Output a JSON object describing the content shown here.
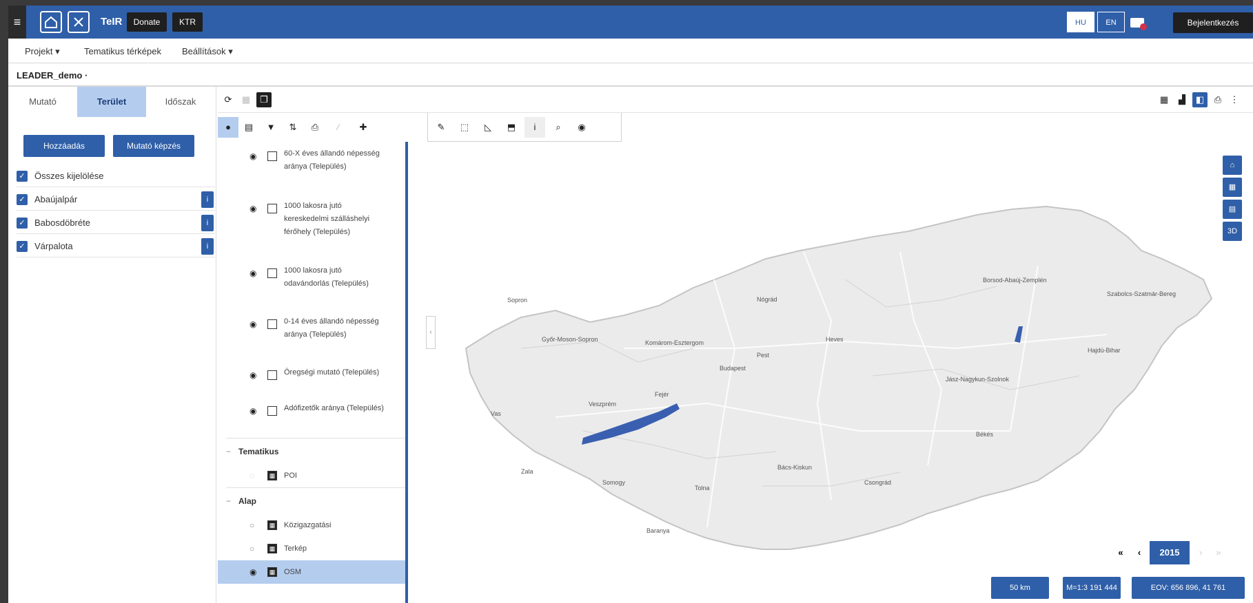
{
  "header": {
    "brand": "TeIR",
    "donate_label": "Donate",
    "ktr_label": "KTR",
    "lang_hu": "HU",
    "lang_en": "EN",
    "login_label": "Bejelentkezés",
    "colors": {
      "primary": "#2f5fa8",
      "dark": "#1f1f1f"
    }
  },
  "menu": {
    "items": [
      {
        "label": "Projekt ▾"
      },
      {
        "label": "Tematikus térképek"
      },
      {
        "label": "Beállítások ▾"
      }
    ]
  },
  "project": {
    "name": "LEADER_demo ·"
  },
  "left_panel": {
    "tabs": [
      {
        "label": "Mutató"
      },
      {
        "label": "Terület"
      },
      {
        "label": "Időszak"
      }
    ],
    "active_tab": "Terület",
    "add_button": "Hozzáadás",
    "indicator_button": "Mutató képzés",
    "select_all": "Összes kijelölése",
    "areas": [
      {
        "label": "Abaújalpár",
        "info": "i"
      },
      {
        "label": "Babosdöbréte",
        "info": "i"
      },
      {
        "label": "Várpalota",
        "info": "i"
      }
    ]
  },
  "layers": {
    "items": [
      {
        "label": "60-X éves állandó népesség aránya (Település)"
      },
      {
        "label": "1000 lakosra jutó kereskedelmi szálláshelyi férőhely (Település)"
      },
      {
        "label": "1000 lakosra jutó odavándorlás (Település)"
      },
      {
        "label": "0-14 éves állandó népesség aránya (Település)"
      },
      {
        "label": "Öregségi mutató (Település)"
      },
      {
        "label": "Adófizetők aránya (Település)"
      }
    ],
    "group_tematikus": "Tematikus",
    "tematikus_items": [
      {
        "label": "POI"
      }
    ],
    "group_alap": "Alap",
    "alap_items": [
      {
        "label": "Közigazgatási"
      },
      {
        "label": "Terkép"
      },
      {
        "label": "OSM"
      }
    ]
  },
  "map": {
    "places": [
      {
        "label": "Sopron"
      },
      {
        "label": "Győr-Moson-Sopron"
      },
      {
        "label": "Komárom-Esztergom"
      },
      {
        "label": "Nógrád"
      },
      {
        "label": "Pest"
      },
      {
        "label": "Budapest"
      },
      {
        "label": "Heves"
      },
      {
        "label": "Borsod-Abaúj-Zemplén"
      },
      {
        "label": "Szabolcs-Szatmár-Bereg"
      },
      {
        "label": "Jász-Nagykun-Szolnok"
      },
      {
        "label": "Hajdú-Bihar"
      },
      {
        "label": "Fejér"
      },
      {
        "label": "Veszprém"
      },
      {
        "label": "Vas"
      },
      {
        "label": "Zala"
      },
      {
        "label": "Somogy"
      },
      {
        "label": "Tolna"
      },
      {
        "label": "Baranya"
      },
      {
        "label": "Bács-Kiskun"
      },
      {
        "label": "Csongrád"
      },
      {
        "label": "Békés"
      }
    ]
  },
  "right_tools": {
    "home": "⌂",
    "b2": "▦",
    "b3": "▤",
    "b4": "3D"
  },
  "timeline": {
    "first": "«",
    "prev": "‹",
    "year": "2015",
    "next": "›",
    "last": "»"
  },
  "footer": {
    "scale": "50 km",
    "ratio": "M=1:3 191 444",
    "coords": "EOV: 656 896, 41 761"
  }
}
